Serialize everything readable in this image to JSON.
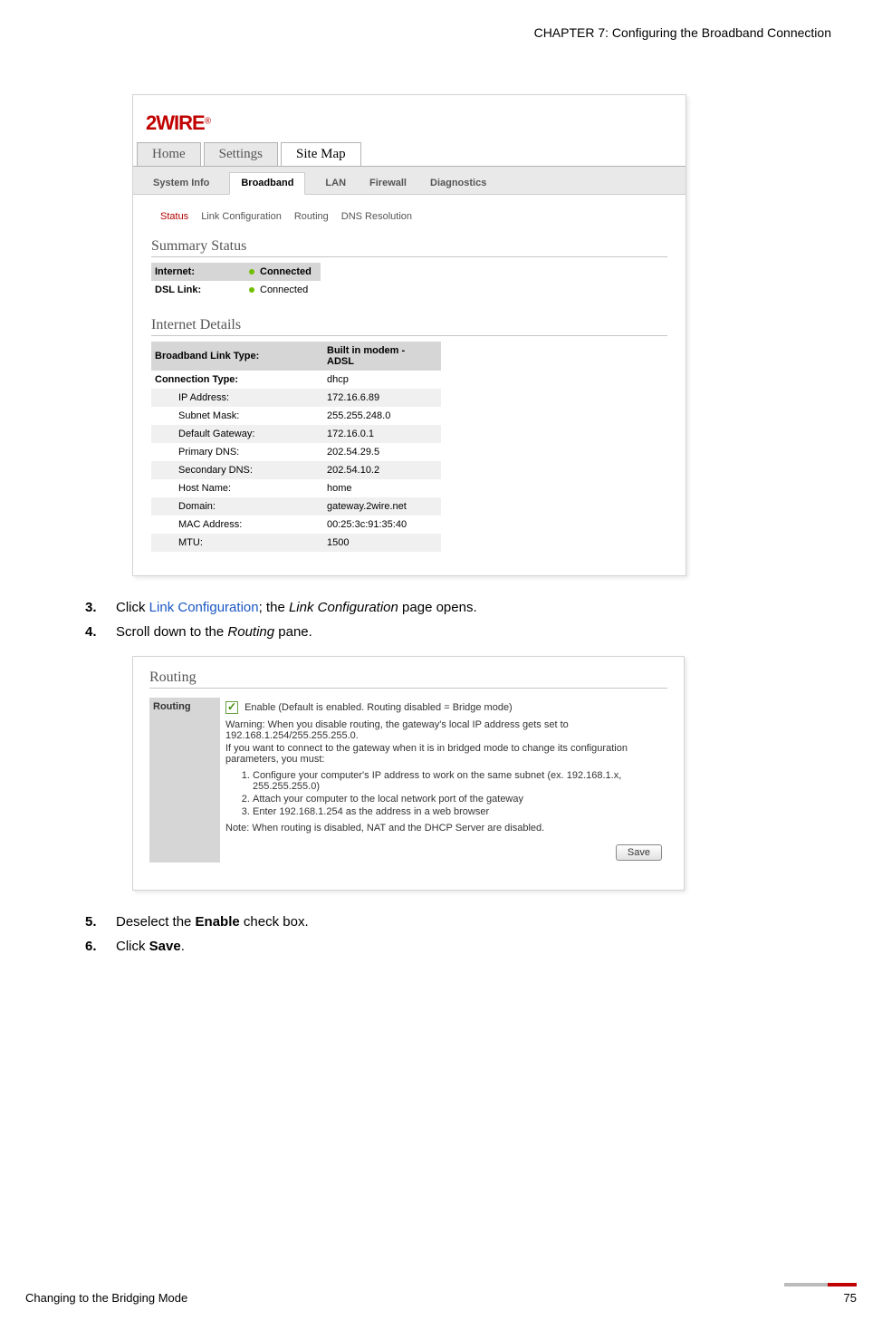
{
  "header": {
    "chapter": "CHAPTER 7: Configuring the Broadband Connection"
  },
  "logo": "2WIRE",
  "mainTabs": [
    {
      "label": "Home",
      "active": false
    },
    {
      "label": "Settings",
      "active": false
    },
    {
      "label": "Site Map",
      "active": true
    }
  ],
  "subTabs": [
    {
      "label": "System Info",
      "active": false
    },
    {
      "label": "Broadband",
      "active": true
    },
    {
      "label": "LAN",
      "active": false
    },
    {
      "label": "Firewall",
      "active": false
    },
    {
      "label": "Diagnostics",
      "active": false
    }
  ],
  "subNav": [
    {
      "label": "Status",
      "active": true
    },
    {
      "label": "Link Configuration",
      "active": false
    },
    {
      "label": "Routing",
      "active": false
    },
    {
      "label": "DNS Resolution",
      "active": false
    }
  ],
  "summary": {
    "title": "Summary Status",
    "rows": [
      {
        "label": "Internet:",
        "value": "Connected",
        "dot": true,
        "hdr": true
      },
      {
        "label": "DSL Link:",
        "value": "Connected",
        "dot": true,
        "hdr": false
      }
    ]
  },
  "details": {
    "title": "Internet Details",
    "rows": [
      {
        "label": "Broadband Link Type:",
        "value": "Built in modem - ADSL",
        "hdr": true,
        "indent": false
      },
      {
        "label": "Connection Type:",
        "value": "dhcp",
        "hdr": false,
        "indent": false,
        "bold": true
      },
      {
        "label": "IP Address:",
        "value": "172.16.6.89",
        "indent": true,
        "alt": true
      },
      {
        "label": "Subnet Mask:",
        "value": "255.255.248.0",
        "indent": true
      },
      {
        "label": "Default Gateway:",
        "value": "172.16.0.1",
        "indent": true,
        "alt": true
      },
      {
        "label": "Primary DNS:",
        "value": "202.54.29.5",
        "indent": true
      },
      {
        "label": "Secondary DNS:",
        "value": "202.54.10.2",
        "indent": true,
        "alt": true
      },
      {
        "label": "Host Name:",
        "value": "home",
        "indent": true
      },
      {
        "label": "Domain:",
        "value": "gateway.2wire.net",
        "indent": true,
        "alt": true
      },
      {
        "label": "MAC Address:",
        "value": "00:25:3c:91:35:40",
        "indent": true
      },
      {
        "label": "MTU:",
        "value": "1500",
        "indent": true,
        "alt": true
      }
    ]
  },
  "steps": {
    "s3_num": "3.",
    "s3_pre": "Click ",
    "s3_link": "Link Configuration",
    "s3_mid": "; the ",
    "s3_it": "Link Configuration",
    "s3_post": " page opens.",
    "s4_num": "4.",
    "s4_pre": "Scroll down to the ",
    "s4_it": "Routing",
    "s4_post": " pane.",
    "s5_num": "5.",
    "s5_pre": "Deselect the ",
    "s5_b": "Enable",
    "s5_post": " check box.",
    "s6_num": "6.",
    "s6_pre": "Click ",
    "s6_b": "Save",
    "s6_post": "."
  },
  "routing": {
    "title": "Routing",
    "label": "Routing",
    "enable": "Enable (Default is enabled. Routing disabled = Bridge mode)",
    "warn1": "Warning: When you disable routing, the gateway's local IP address gets set to 192.168.1.254/255.255.255.0.",
    "warn2": "If you want to connect to the gateway when it is in bridged mode to change its configuration parameters, you must:",
    "ol1": "Configure your computer's IP address to work on the same subnet (ex. 192.168.1.x, 255.255.255.0)",
    "ol2": "Attach your computer to the local network port of the gateway",
    "ol3": "Enter 192.168.1.254 as the address in a web browser",
    "note": "Note: When routing is disabled, NAT and the DHCP Server are disabled.",
    "save": "Save"
  },
  "footer": {
    "left": "Changing to the Bridging Mode",
    "right": "75"
  }
}
